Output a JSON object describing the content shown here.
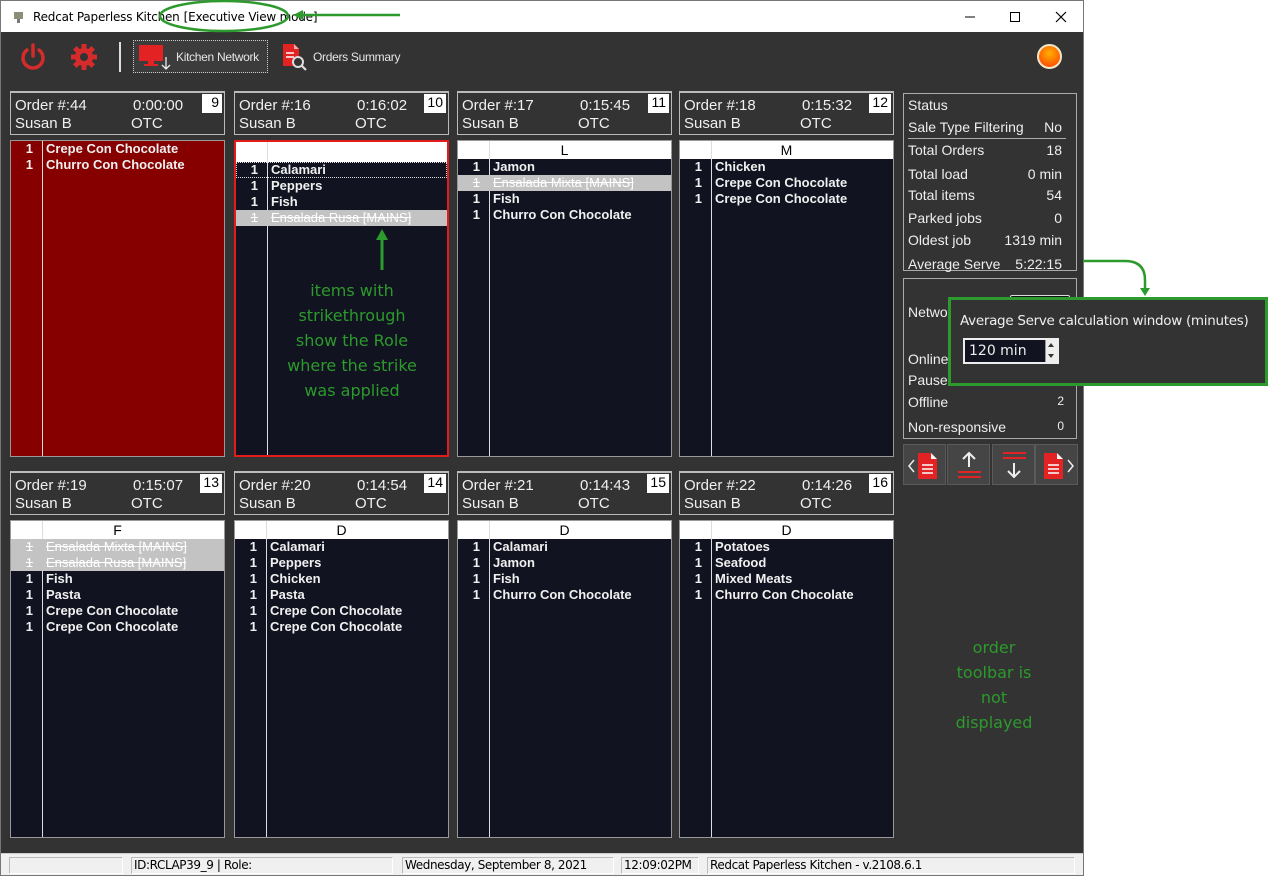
{
  "window": {
    "title": "Redcat Paperless Kitchen",
    "mode": "[Executive View mode]",
    "minimize_icon": "minimize-icon",
    "maximize_icon": "maximize-icon",
    "close_icon": "close-icon"
  },
  "toolbar": {
    "power_icon": "power-icon",
    "settings_icon": "gear-icon",
    "kitchen_network_label": "Kitchen Network",
    "orders_summary_label": "Orders Summary",
    "status_light_color": "#ff7a00"
  },
  "orders": [
    {
      "number": "Order #:44",
      "time": "0:00:00",
      "badge": "9",
      "name": "Susan B",
      "type": "OTC",
      "role": "",
      "style": "red",
      "items": [
        {
          "qty": "1",
          "name": "Crepe Con Chocolate"
        },
        {
          "qty": "1",
          "name": "Churro Con Chocolate"
        }
      ]
    },
    {
      "number": "Order #:16",
      "time": "0:16:02",
      "badge": "10",
      "name": "Susan B",
      "type": "OTC",
      "role": "",
      "style": "selected",
      "items": [
        {
          "qty": "1",
          "name": "Calamari",
          "focus": true
        },
        {
          "qty": "1",
          "name": "Peppers"
        },
        {
          "qty": "1",
          "name": "Fish"
        },
        {
          "qty": "1",
          "name": "Ensalada Rusa [MAINS]",
          "struck": true
        }
      ]
    },
    {
      "number": "Order #:17",
      "time": "0:15:45",
      "badge": "11",
      "name": "Susan B",
      "type": "OTC",
      "role": "L",
      "style": "",
      "items": [
        {
          "qty": "1",
          "name": "Jamon"
        },
        {
          "qty": "1",
          "name": "Ensalada Mixta [MAINS]",
          "struck": true
        },
        {
          "qty": "1",
          "name": "Fish"
        },
        {
          "qty": "1",
          "name": "Churro Con Chocolate"
        }
      ]
    },
    {
      "number": "Order #:18",
      "time": "0:15:32",
      "badge": "12",
      "name": "Susan B",
      "type": "OTC",
      "role": "M",
      "style": "",
      "items": [
        {
          "qty": "1",
          "name": "Chicken"
        },
        {
          "qty": "1",
          "name": "Crepe Con Chocolate"
        },
        {
          "qty": "1",
          "name": "Crepe Con Chocolate"
        }
      ]
    },
    {
      "number": "Order #:19",
      "time": "0:15:07",
      "badge": "13",
      "name": "Susan B",
      "type": "OTC",
      "role": "F",
      "style": "",
      "items": [
        {
          "qty": "1",
          "name": "Ensalada Mixta [MAINS]",
          "struck": true
        },
        {
          "qty": "1",
          "name": "Ensalada Rusa [MAINS]",
          "struck": true
        },
        {
          "qty": "1",
          "name": "Fish"
        },
        {
          "qty": "1",
          "name": "Pasta"
        },
        {
          "qty": "1",
          "name": "Crepe Con Chocolate"
        },
        {
          "qty": "1",
          "name": "Crepe Con Chocolate"
        }
      ]
    },
    {
      "number": "Order #:20",
      "time": "0:14:54",
      "badge": "14",
      "name": "Susan B",
      "type": "OTC",
      "role": "D",
      "style": "",
      "items": [
        {
          "qty": "1",
          "name": "Calamari"
        },
        {
          "qty": "1",
          "name": "Peppers"
        },
        {
          "qty": "1",
          "name": "Chicken"
        },
        {
          "qty": "1",
          "name": "Pasta"
        },
        {
          "qty": "1",
          "name": "Crepe Con Chocolate"
        },
        {
          "qty": "1",
          "name": "Crepe Con Chocolate"
        }
      ]
    },
    {
      "number": "Order #:21",
      "time": "0:14:43",
      "badge": "15",
      "name": "Susan B",
      "type": "OTC",
      "role": "D",
      "style": "",
      "items": [
        {
          "qty": "1",
          "name": "Calamari"
        },
        {
          "qty": "1",
          "name": "Jamon"
        },
        {
          "qty": "1",
          "name": "Fish"
        },
        {
          "qty": "1",
          "name": "Churro Con Chocolate"
        }
      ]
    },
    {
      "number": "Order #:22",
      "time": "0:14:26",
      "badge": "16",
      "name": "Susan B",
      "type": "OTC",
      "role": "D",
      "style": "",
      "items": [
        {
          "qty": "1",
          "name": "Potatoes"
        },
        {
          "qty": "1",
          "name": "Seafood"
        },
        {
          "qty": "1",
          "name": "Mixed Meats"
        },
        {
          "qty": "1",
          "name": "Churro Con Chocolate"
        }
      ]
    }
  ],
  "status": {
    "title": "Status",
    "rows": [
      {
        "label": "Sale Type Filtering",
        "value": "No"
      },
      {
        "label": "Total Orders",
        "value": "18"
      },
      {
        "label": "Total load",
        "value": "0 min"
      },
      {
        "label": "Total items",
        "value": "54"
      },
      {
        "label": "Parked jobs",
        "value": "0"
      },
      {
        "label": "Oldest job",
        "value": "1319 min"
      },
      {
        "label": "Average Serve",
        "value": "5:22:15"
      }
    ]
  },
  "network": {
    "label": "Netwo",
    "rows": [
      {
        "label": "Online",
        "value": ""
      },
      {
        "label": "Pause",
        "value": ""
      },
      {
        "label": "Offline",
        "value": "2"
      },
      {
        "label": "Non-responsive",
        "value": "0"
      }
    ]
  },
  "nav_buttons": [
    "prev-order-icon",
    "move-up-icon",
    "move-down-icon",
    "next-order-icon"
  ],
  "popup": {
    "label": "Average Serve calculation window (minutes)",
    "value": "120 min"
  },
  "annotations": {
    "strike_note": [
      "items with",
      "strikethrough",
      "show the Role",
      "where the strike",
      "was applied"
    ],
    "toolbar_note": [
      "order",
      "toolbar is",
      "not",
      "displayed"
    ],
    "accent": "#2c9a2c"
  },
  "statusbar": {
    "cell0": "",
    "id_role": "ID:RCLAP39_9 | Role:",
    "date": "Wednesday, September  8, 2021",
    "time": "12:09:02PM",
    "version": "Redcat Paperless Kitchen - v.2108.6.1"
  }
}
